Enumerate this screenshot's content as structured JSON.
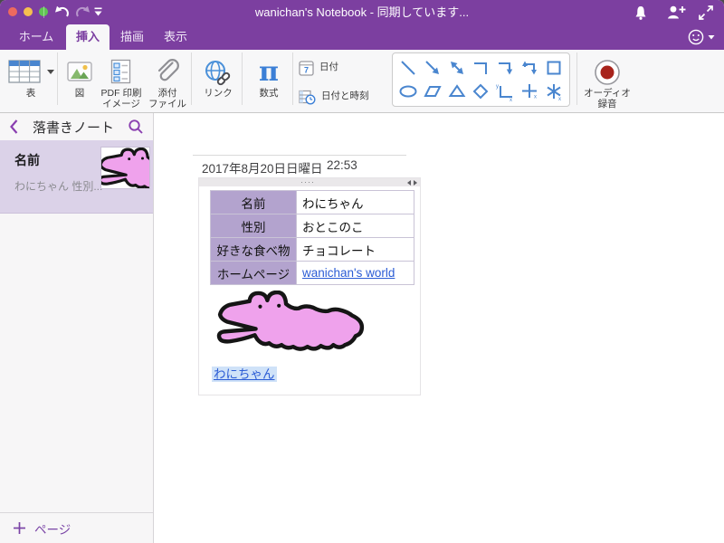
{
  "window": {
    "title": "wanichan's Notebook - 同期しています..."
  },
  "titlebar_icons": [
    "undo-icon",
    "redo-icon",
    "toolbar-options-icon",
    "notifications-bell-icon",
    "share-add-person-icon",
    "enter-fullscreen-icon"
  ],
  "tabs": {
    "home": "ホーム",
    "insert": "挿入",
    "draw": "描画",
    "view": "表示"
  },
  "ribbon": {
    "table": {
      "label": "表"
    },
    "picture": {
      "label": "図"
    },
    "pdf_printout": {
      "line1": "PDF 印刷",
      "line2": "イメージ"
    },
    "attachment": {
      "line1": "添付",
      "line2": "ファイル"
    },
    "link": {
      "label": "リンク"
    },
    "equation": {
      "label": "数式",
      "symbol": "π"
    },
    "date": {
      "label": "日付",
      "calendar_day": "7"
    },
    "datetime": {
      "label": "日付と時刻"
    },
    "shapes": [
      "line",
      "arrow",
      "double-arrow",
      "elbow-connector",
      "elbow-arrow",
      "elbow-double-arrow",
      "rectangle",
      "ellipse",
      "parallelogram",
      "triangle",
      "diamond",
      "chart-axes",
      "cross-axes",
      "star-axes"
    ],
    "audio": {
      "line1": "オーディオ",
      "line2": "録音"
    }
  },
  "sidebar": {
    "notebook_title": "落書きノート",
    "page_item": {
      "title": "名前",
      "snippet": "わにちゃん 性別..."
    },
    "add_page_label": "ページ"
  },
  "page": {
    "date": "2017年8月20日日曜日",
    "time": "22:53",
    "outline_handle": "····",
    "info_table": {
      "rows": [
        {
          "label": "名前",
          "value": "わにちゃん"
        },
        {
          "label": "性別",
          "value": "おとこのこ"
        },
        {
          "label": "好きな食べ物",
          "value": "チョコレート"
        },
        {
          "label": "ホームページ",
          "value": "wanichan's world",
          "link": true
        }
      ]
    },
    "drawing": "pink-crocodile-doodle",
    "selected_link_text": "わにちゃん"
  },
  "colors": {
    "accent_purple": "#7c3fa0",
    "sidebar_selection": "#dbd2e8",
    "table_header_bg": "#b3a3ce",
    "link_blue": "#2b5cd5",
    "selection_highlight": "#cfe2f8",
    "doodle_pink": "#efa2ec",
    "record_red": "#a8241c",
    "shape_blue": "#4a86cf"
  }
}
